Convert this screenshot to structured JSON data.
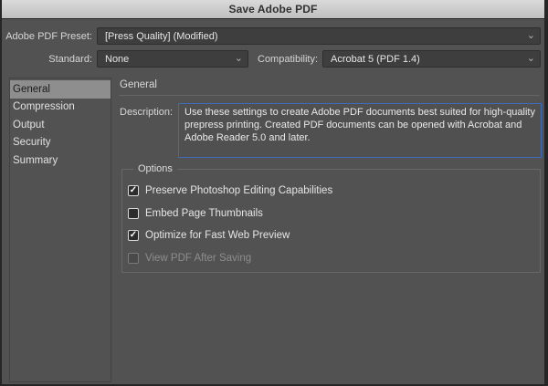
{
  "window": {
    "title": "Save Adobe PDF"
  },
  "header": {
    "preset_label": "Adobe PDF Preset:",
    "preset_value": "[Press Quality] (Modified)",
    "standard_label": "Standard:",
    "standard_value": "None",
    "compatibility_label": "Compatibility:",
    "compatibility_value": "Acrobat 5 (PDF 1.4)"
  },
  "sidebar": {
    "items": [
      {
        "label": "General",
        "selected": true
      },
      {
        "label": "Compression",
        "selected": false
      },
      {
        "label": "Output",
        "selected": false
      },
      {
        "label": "Security",
        "selected": false
      },
      {
        "label": "Summary",
        "selected": false
      }
    ]
  },
  "panel": {
    "heading": "General",
    "description_label": "Description:",
    "description_text": "Use these settings to create Adobe PDF documents best suited for high-quality prepress printing.  Created PDF documents can be opened with Acrobat and Adobe Reader 5.0 and later.",
    "options": {
      "legend": "Options",
      "checkboxes": [
        {
          "label": "Preserve Photoshop Editing Capabilities",
          "checked": true,
          "disabled": false
        },
        {
          "label": "Embed Page Thumbnails",
          "checked": false,
          "disabled": false
        },
        {
          "label": "Optimize for Fast Web Preview",
          "checked": true,
          "disabled": false
        },
        {
          "label": "View PDF After Saving",
          "checked": false,
          "disabled": true
        }
      ]
    }
  },
  "icons": {
    "dropdown_chevron": "⌄",
    "checkmark": "✓"
  },
  "colors": {
    "window_bg": "#525252",
    "titlebar_top": "#dadada",
    "titlebar_bottom": "#bfbfbf",
    "dropdown_bg": "#3e3e3e",
    "selected_item_bg": "#8e8e8e",
    "focus_border_blue": "#3d6cba",
    "text_light": "#e6e6e6"
  }
}
